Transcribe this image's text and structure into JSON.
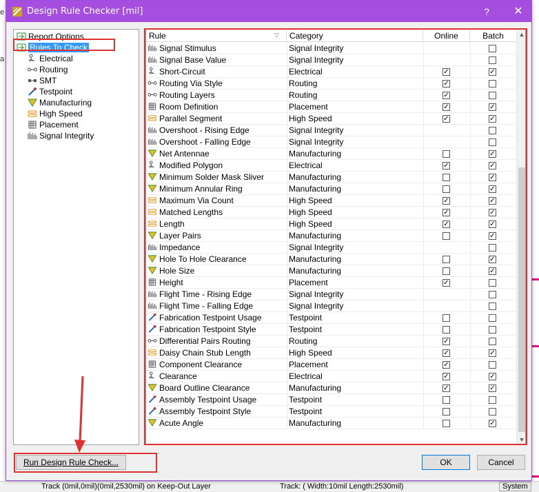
{
  "window": {
    "title": "Design Rule Checker [mil]",
    "help_label": "?",
    "close_label": "✕"
  },
  "tree": {
    "items": [
      {
        "label": "Report Options",
        "icon": "report-options-icon"
      },
      {
        "label": "Rules To Check",
        "icon": "rules-to-check-icon",
        "selected": true
      },
      {
        "label": "Electrical",
        "icon": "electrical-icon"
      },
      {
        "label": "Routing",
        "icon": "routing-icon"
      },
      {
        "label": "SMT",
        "icon": "smt-icon"
      },
      {
        "label": "Testpoint",
        "icon": "testpoint-icon"
      },
      {
        "label": "Manufacturing",
        "icon": "manufacturing-icon"
      },
      {
        "label": "High Speed",
        "icon": "high-speed-icon"
      },
      {
        "label": "Placement",
        "icon": "placement-icon"
      },
      {
        "label": "Signal Integrity",
        "icon": "signal-integrity-icon"
      }
    ]
  },
  "grid": {
    "headers": {
      "rule": "Rule",
      "category": "Category",
      "online": "Online",
      "batch": "Batch"
    },
    "rows": [
      {
        "rule": "Signal Stimulus",
        "category": "Signal Integrity",
        "online": null,
        "batch": false
      },
      {
        "rule": "Signal Base Value",
        "category": "Signal Integrity",
        "online": null,
        "batch": false
      },
      {
        "rule": "Short-Circuit",
        "category": "Electrical",
        "online": true,
        "batch": true
      },
      {
        "rule": "Routing Via Style",
        "category": "Routing",
        "online": true,
        "batch": false
      },
      {
        "rule": "Routing Layers",
        "category": "Routing",
        "online": true,
        "batch": false
      },
      {
        "rule": "Room Definition",
        "category": "Placement",
        "online": true,
        "batch": true
      },
      {
        "rule": "Parallel Segment",
        "category": "High Speed",
        "online": true,
        "batch": true
      },
      {
        "rule": "Overshoot - Rising Edge",
        "category": "Signal Integrity",
        "online": null,
        "batch": false
      },
      {
        "rule": "Overshoot - Falling Edge",
        "category": "Signal Integrity",
        "online": null,
        "batch": false
      },
      {
        "rule": "Net Antennae",
        "category": "Manufacturing",
        "online": false,
        "batch": true
      },
      {
        "rule": "Modified Polygon",
        "category": "Electrical",
        "online": true,
        "batch": true
      },
      {
        "rule": "Minimum Solder Mask Sliver",
        "category": "Manufacturing",
        "online": false,
        "batch": true
      },
      {
        "rule": "Minimum Annular Ring",
        "category": "Manufacturing",
        "online": false,
        "batch": true
      },
      {
        "rule": "Maximum Via Count",
        "category": "High Speed",
        "online": true,
        "batch": true
      },
      {
        "rule": "Matched Lengths",
        "category": "High Speed",
        "online": true,
        "batch": true
      },
      {
        "rule": "Length",
        "category": "High Speed",
        "online": true,
        "batch": true
      },
      {
        "rule": "Layer Pairs",
        "category": "Manufacturing",
        "online": false,
        "batch": true
      },
      {
        "rule": "Impedance",
        "category": "Signal Integrity",
        "online": null,
        "batch": false
      },
      {
        "rule": "Hole To Hole Clearance",
        "category": "Manufacturing",
        "online": false,
        "batch": true
      },
      {
        "rule": "Hole Size",
        "category": "Manufacturing",
        "online": false,
        "batch": true
      },
      {
        "rule": "Height",
        "category": "Placement",
        "online": true,
        "batch": false
      },
      {
        "rule": "Flight Time - Rising Edge",
        "category": "Signal Integrity",
        "online": null,
        "batch": false
      },
      {
        "rule": "Flight Time - Falling Edge",
        "category": "Signal Integrity",
        "online": null,
        "batch": false
      },
      {
        "rule": "Fabrication Testpoint Usage",
        "category": "Testpoint",
        "online": false,
        "batch": false
      },
      {
        "rule": "Fabrication Testpoint Style",
        "category": "Testpoint",
        "online": false,
        "batch": false
      },
      {
        "rule": "Differential Pairs Routing",
        "category": "Routing",
        "online": true,
        "batch": false
      },
      {
        "rule": "Daisy Chain Stub Length",
        "category": "High Speed",
        "online": true,
        "batch": true
      },
      {
        "rule": "Component Clearance",
        "category": "Placement",
        "online": true,
        "batch": false
      },
      {
        "rule": "Clearance",
        "category": "Electrical",
        "online": true,
        "batch": true
      },
      {
        "rule": "Board Outline Clearance",
        "category": "Manufacturing",
        "online": true,
        "batch": true
      },
      {
        "rule": "Assembly Testpoint Usage",
        "category": "Testpoint",
        "online": false,
        "batch": false
      },
      {
        "rule": "Assembly Testpoint Style",
        "category": "Testpoint",
        "online": false,
        "batch": false
      },
      {
        "rule": "Acute Angle",
        "category": "Manufacturing",
        "online": false,
        "batch": true
      }
    ]
  },
  "buttons": {
    "run": "Run Design Rule Check...",
    "ok": "OK",
    "cancel": "Cancel"
  },
  "statusbar": {
    "left": "Track (0mil,0mil)(0mil,2530mil) on Keep-Out Layer",
    "right": "Track: ( Width:10mil Length:2530mil)",
    "system": "System"
  },
  "colors": {
    "titlebar": "#a54ee0",
    "selection": "#3399ff",
    "highlight": "#e0302f"
  }
}
